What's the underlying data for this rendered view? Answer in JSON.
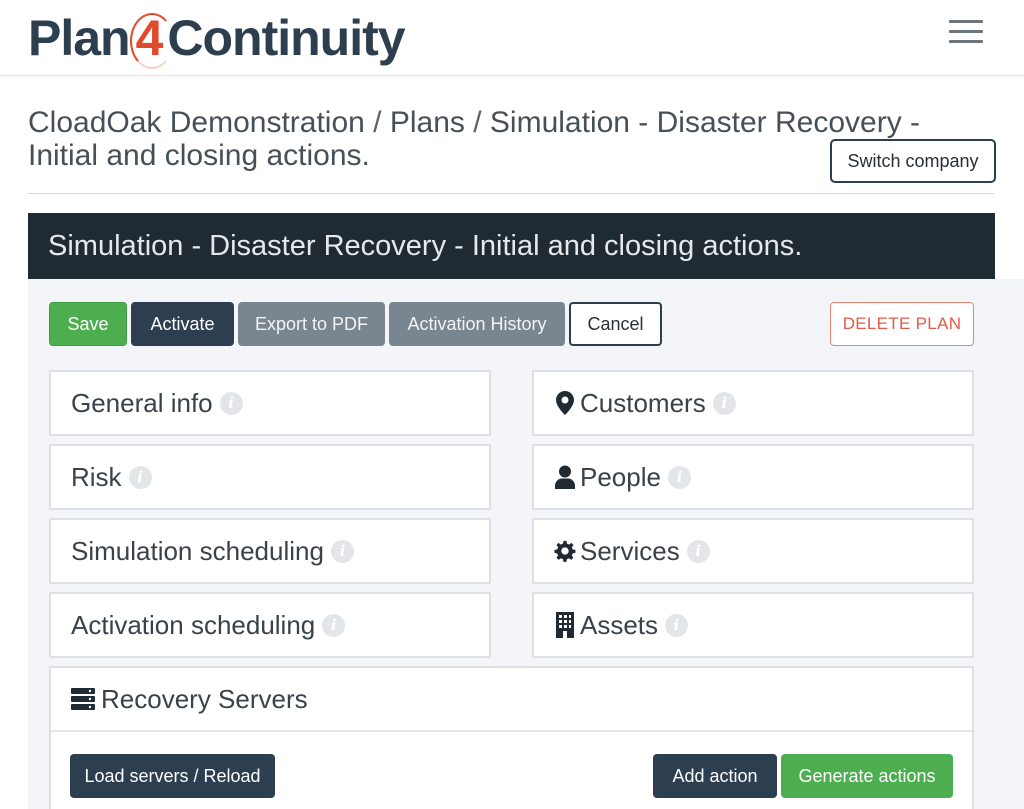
{
  "app": {
    "logo_part1": "Plan",
    "logo_part2": "4",
    "logo_part3": "Continuity"
  },
  "breadcrumb": {
    "company": "CloadOak Demonstration",
    "separator": " / ",
    "section": "Plans",
    "current": "Simulation - Disaster Recovery - Initial and closing actions."
  },
  "switch_company_label": "Switch company",
  "plan": {
    "title": "Simulation - Disaster Recovery - Initial and closing actions."
  },
  "toolbar": {
    "save": "Save",
    "activate": "Activate",
    "export_pdf": "Export to PDF",
    "activation_history": "Activation History",
    "cancel": "Cancel",
    "delete_plan": "DELETE PLAN"
  },
  "sections_left": [
    {
      "label": "General info",
      "icon": null
    },
    {
      "label": "Risk",
      "icon": null
    },
    {
      "label": "Simulation scheduling",
      "icon": null
    },
    {
      "label": "Activation scheduling",
      "icon": null
    }
  ],
  "sections_right": [
    {
      "label": "Customers",
      "icon": "map-marker-icon"
    },
    {
      "label": "People",
      "icon": "user-icon"
    },
    {
      "label": "Services",
      "icon": "gear-icon"
    },
    {
      "label": "Assets",
      "icon": "building-icon"
    }
  ],
  "info_glyph": "i",
  "recovery": {
    "title": "Recovery Servers",
    "icon": "server-icon",
    "load_label": "Load servers / Reload",
    "add_label": "Add action",
    "generate_label": "Generate actions"
  },
  "colors": {
    "primary_dark": "#2c3e50",
    "success": "#4dae50",
    "secondary": "#7a868f",
    "danger": "#e35a4a",
    "header_bg": "#1f2a33",
    "logo_accent": "#e04b2e"
  }
}
